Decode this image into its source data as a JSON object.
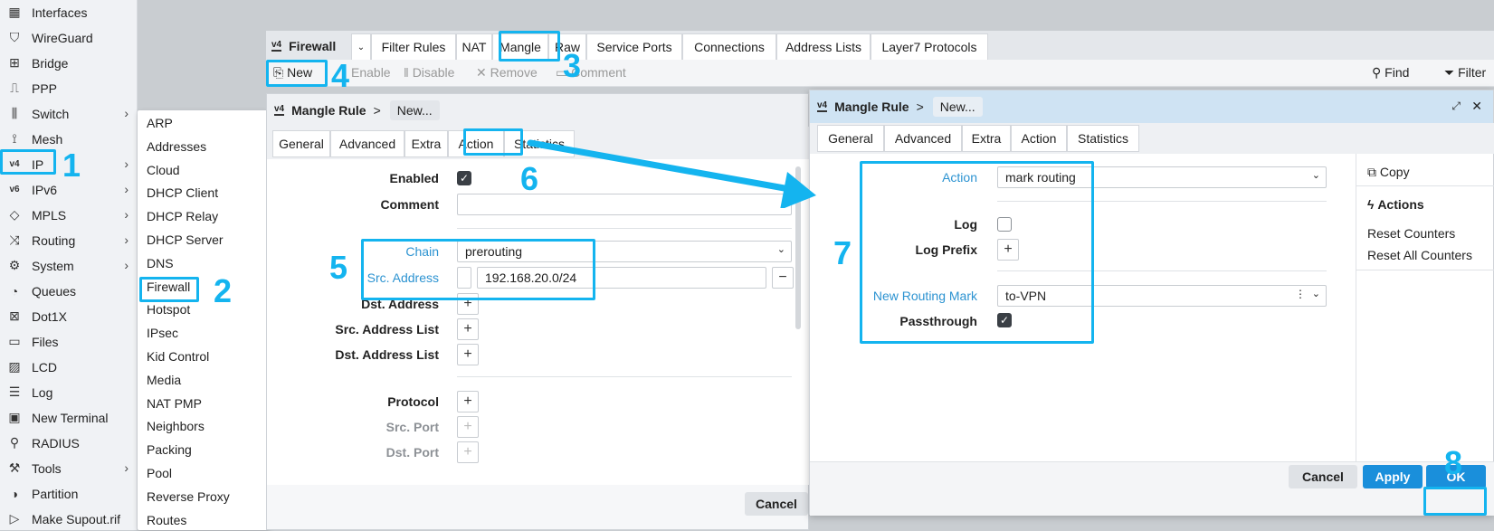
{
  "sidebar": {
    "items": [
      {
        "label": "Interfaces",
        "icon": "interfaces-icon",
        "glyph": "▦"
      },
      {
        "label": "WireGuard",
        "icon": "wireguard-icon",
        "glyph": "⛉"
      },
      {
        "label": "Bridge",
        "icon": "bridge-icon",
        "glyph": "⊞"
      },
      {
        "label": "PPP",
        "icon": "ppp-icon",
        "glyph": "⎍"
      },
      {
        "label": "Switch",
        "icon": "switch-icon",
        "glyph": "⫼",
        "arrow": "›"
      },
      {
        "label": "Mesh",
        "icon": "mesh-icon",
        "glyph": "⟟"
      },
      {
        "label": "IP",
        "icon": "ip-icon",
        "glyph": "v4",
        "arrow": "›"
      },
      {
        "label": "IPv6",
        "icon": "ipv6-icon",
        "glyph": "v6",
        "arrow": "›"
      },
      {
        "label": "MPLS",
        "icon": "mpls-icon",
        "glyph": "◇",
        "arrow": "›"
      },
      {
        "label": "Routing",
        "icon": "routing-icon",
        "glyph": "⤨",
        "arrow": "›"
      },
      {
        "label": "System",
        "icon": "system-icon",
        "glyph": "⚙",
        "arrow": "›"
      },
      {
        "label": "Queues",
        "icon": "queues-icon",
        "glyph": "◔"
      },
      {
        "label": "Dot1X",
        "icon": "dot1x-icon",
        "glyph": "⊠"
      },
      {
        "label": "Files",
        "icon": "files-icon",
        "glyph": "▭"
      },
      {
        "label": "LCD",
        "icon": "lcd-icon",
        "glyph": "▨"
      },
      {
        "label": "Log",
        "icon": "log-icon",
        "glyph": "☰"
      },
      {
        "label": "New Terminal",
        "icon": "terminal-icon",
        "glyph": "▣"
      },
      {
        "label": "RADIUS",
        "icon": "radius-icon",
        "glyph": "⚲"
      },
      {
        "label": "Tools",
        "icon": "tools-icon",
        "glyph": "⚒",
        "arrow": "›"
      },
      {
        "label": "Partition",
        "icon": "partition-icon",
        "glyph": "◑"
      },
      {
        "label": "Make Supout.rif",
        "icon": "supout-icon",
        "glyph": "▷"
      }
    ]
  },
  "submenu": [
    "ARP",
    "Addresses",
    "Cloud",
    "DHCP Client",
    "DHCP Relay",
    "DHCP Server",
    "DNS",
    "Firewall",
    "Hotspot",
    "IPsec",
    "Kid Control",
    "Media",
    "NAT PMP",
    "Neighbors",
    "Packing",
    "Pool",
    "Reverse Proxy",
    "Routes"
  ],
  "firewall": {
    "title": "Firewall",
    "badge": "v4",
    "tabs": [
      "Filter Rules",
      "NAT",
      "Mangle",
      "Raw",
      "Service Ports",
      "Connections",
      "Address Lists",
      "Layer7 Protocols"
    ],
    "toolbar": {
      "new": "New",
      "enable": "Enable",
      "disable": "Disable",
      "remove": "Remove",
      "comment": "Comment",
      "find": "Find",
      "filter": "Filter"
    }
  },
  "left_panel": {
    "title": "Mangle Rule",
    "crumb": "New...",
    "tabs": [
      "General",
      "Advanced",
      "Extra",
      "Action",
      "Statistics"
    ],
    "fields": {
      "enabled": "Enabled",
      "comment": "Comment",
      "chain": "Chain",
      "chain_value": "prerouting",
      "src_address": "Src. Address",
      "src_address_value": "192.168.20.0/24",
      "dst_address": "Dst. Address",
      "src_address_list": "Src. Address List",
      "dst_address_list": "Dst. Address List",
      "protocol": "Protocol",
      "src_port": "Src. Port",
      "dst_port": "Dst. Port"
    },
    "cancel": "Cancel"
  },
  "right_panel": {
    "title": "Mangle Rule",
    "crumb": "New...",
    "tabs": [
      "General",
      "Advanced",
      "Extra",
      "Action",
      "Statistics"
    ],
    "fields": {
      "action": "Action",
      "action_value": "mark routing",
      "log": "Log",
      "log_prefix": "Log Prefix",
      "new_routing_mark": "New Routing Mark",
      "new_routing_mark_value": "to-VPN",
      "passthrough": "Passthrough"
    },
    "side": {
      "copy": "Copy",
      "actions": "Actions",
      "reset_counters": "Reset Counters",
      "reset_all_counters": "Reset All Counters"
    },
    "buttons": {
      "cancel": "Cancel",
      "apply": "Apply",
      "ok": "OK"
    }
  },
  "steps": [
    "1",
    "2",
    "3",
    "4",
    "5",
    "6",
    "7",
    "8"
  ],
  "colors": {
    "highlight": "#14b4ef",
    "apply": "#1a8fdb",
    "label_blue": "#2c93d1"
  }
}
